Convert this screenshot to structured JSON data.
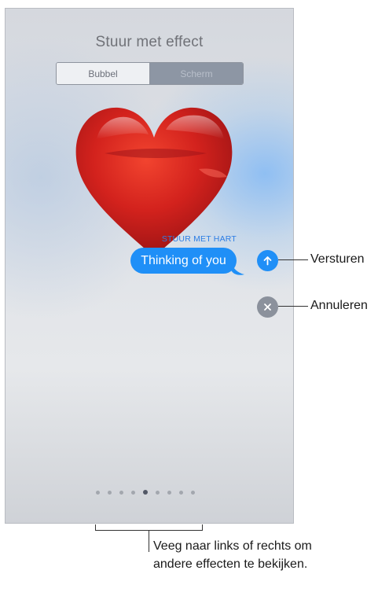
{
  "screen": {
    "title": "Stuur met effect",
    "segments": [
      {
        "label": "Bubbel",
        "selected": false
      },
      {
        "label": "Scherm",
        "selected": true
      }
    ],
    "effect_label": "STUUR MET HART",
    "message": {
      "text": "Thinking of you",
      "color": "#1f8ff7"
    },
    "send_button": {
      "icon": "arrow-up-icon",
      "color": "#1f8ff7"
    },
    "cancel_button": {
      "icon": "close-icon",
      "color": "#8b919c"
    },
    "page_indicator": {
      "count": 9,
      "active_index": 4
    },
    "effect": {
      "icon": "heart-icon",
      "color": "#d6201f"
    }
  },
  "callouts": {
    "send": "Versturen",
    "cancel": "Annuleren",
    "swipe": "Veeg naar links of rechts om andere effecten te bekijken."
  }
}
